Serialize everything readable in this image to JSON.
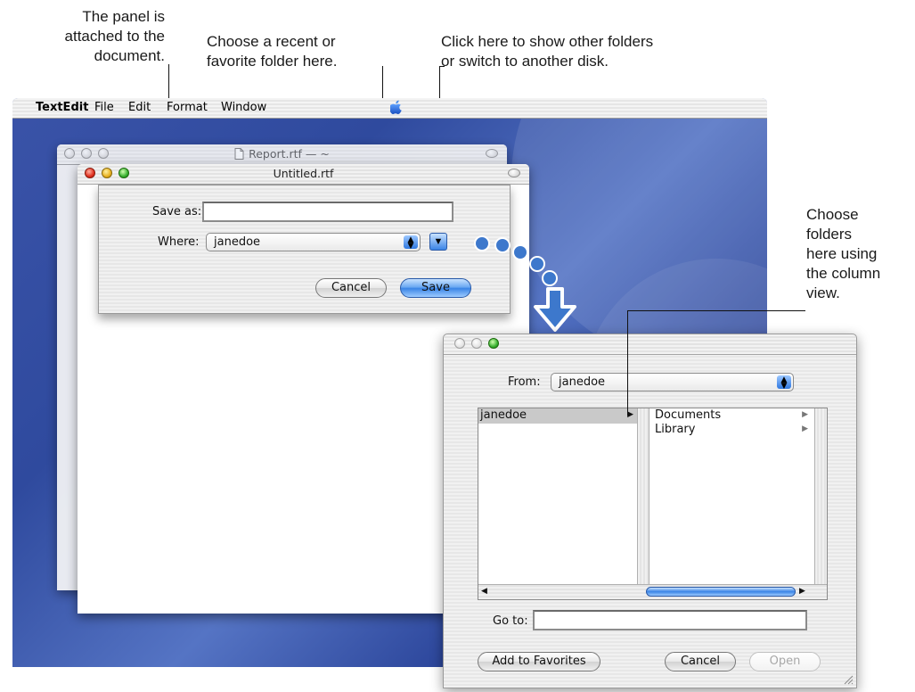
{
  "annotations": {
    "panel_attached": [
      "The panel is",
      "attached to the",
      "document."
    ],
    "recent_folder": [
      "Choose a recent or",
      "favorite folder here."
    ],
    "other_folders": [
      "Click here to show other folders",
      "or switch to another disk."
    ],
    "column_view": [
      "Choose",
      "folders",
      "here using",
      "the column",
      "view."
    ]
  },
  "menubar": {
    "app": "TextEdit",
    "items": [
      "File",
      "Edit",
      "Format",
      "Window"
    ],
    "apple_icon": "apple-logo-icon"
  },
  "back_window": {
    "title": "Report.rtf  —  ~"
  },
  "front_window": {
    "title": "Untitled.rtf"
  },
  "save_sheet": {
    "save_as_label": "Save as:",
    "save_as_value": "",
    "where_label": "Where:",
    "where_value": "janedoe",
    "cancel_label": "Cancel",
    "save_label": "Save",
    "expand_icon": "disclosure-triangle-down-icon"
  },
  "expanded_dialog": {
    "from_label": "From:",
    "from_value": "janedoe",
    "column1": [
      {
        "label": "janedoe",
        "selected": true,
        "has_children": true
      }
    ],
    "column2": [
      {
        "label": "Documents",
        "has_children": true
      },
      {
        "label": "Library",
        "has_children": true
      }
    ],
    "goto_label": "Go to:",
    "goto_value": "",
    "add_favorites_label": "Add to Favorites",
    "cancel_label": "Cancel",
    "open_label": "Open"
  },
  "colors": {
    "desktop": "#3a53a8",
    "selection": "#c9c9c9",
    "default_button": "#3a84e6",
    "flow_dots": "#3d78cc"
  }
}
